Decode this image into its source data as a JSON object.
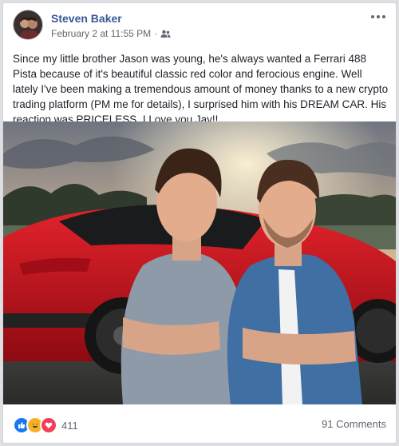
{
  "post": {
    "author": "Steven Baker",
    "date": "February 2 at 11:55 PM",
    "separator": "·",
    "privacy_icon": "friends-icon",
    "text": "Since my little brother Jason was young, he's always wanted a Ferrari 488 Pista because of it's beautiful classic red color and ferocious engine. Well lately I've been making a tremendous amount of money thanks to a new crypto trading platform (PM me for details), I surprised him with his DREAM CAR. His reaction was PRICELESS. I Love you Jay!!"
  },
  "footer": {
    "reactions": [
      "like",
      "haha",
      "love"
    ],
    "reaction_count": "411",
    "comments": "91 Comments"
  },
  "colors": {
    "link": "#385898",
    "meta": "#616770",
    "car_red": "#c8111c",
    "like_blue": "#1877f2",
    "love_red": "#f33e58",
    "haha_yellow": "#f7b125"
  }
}
